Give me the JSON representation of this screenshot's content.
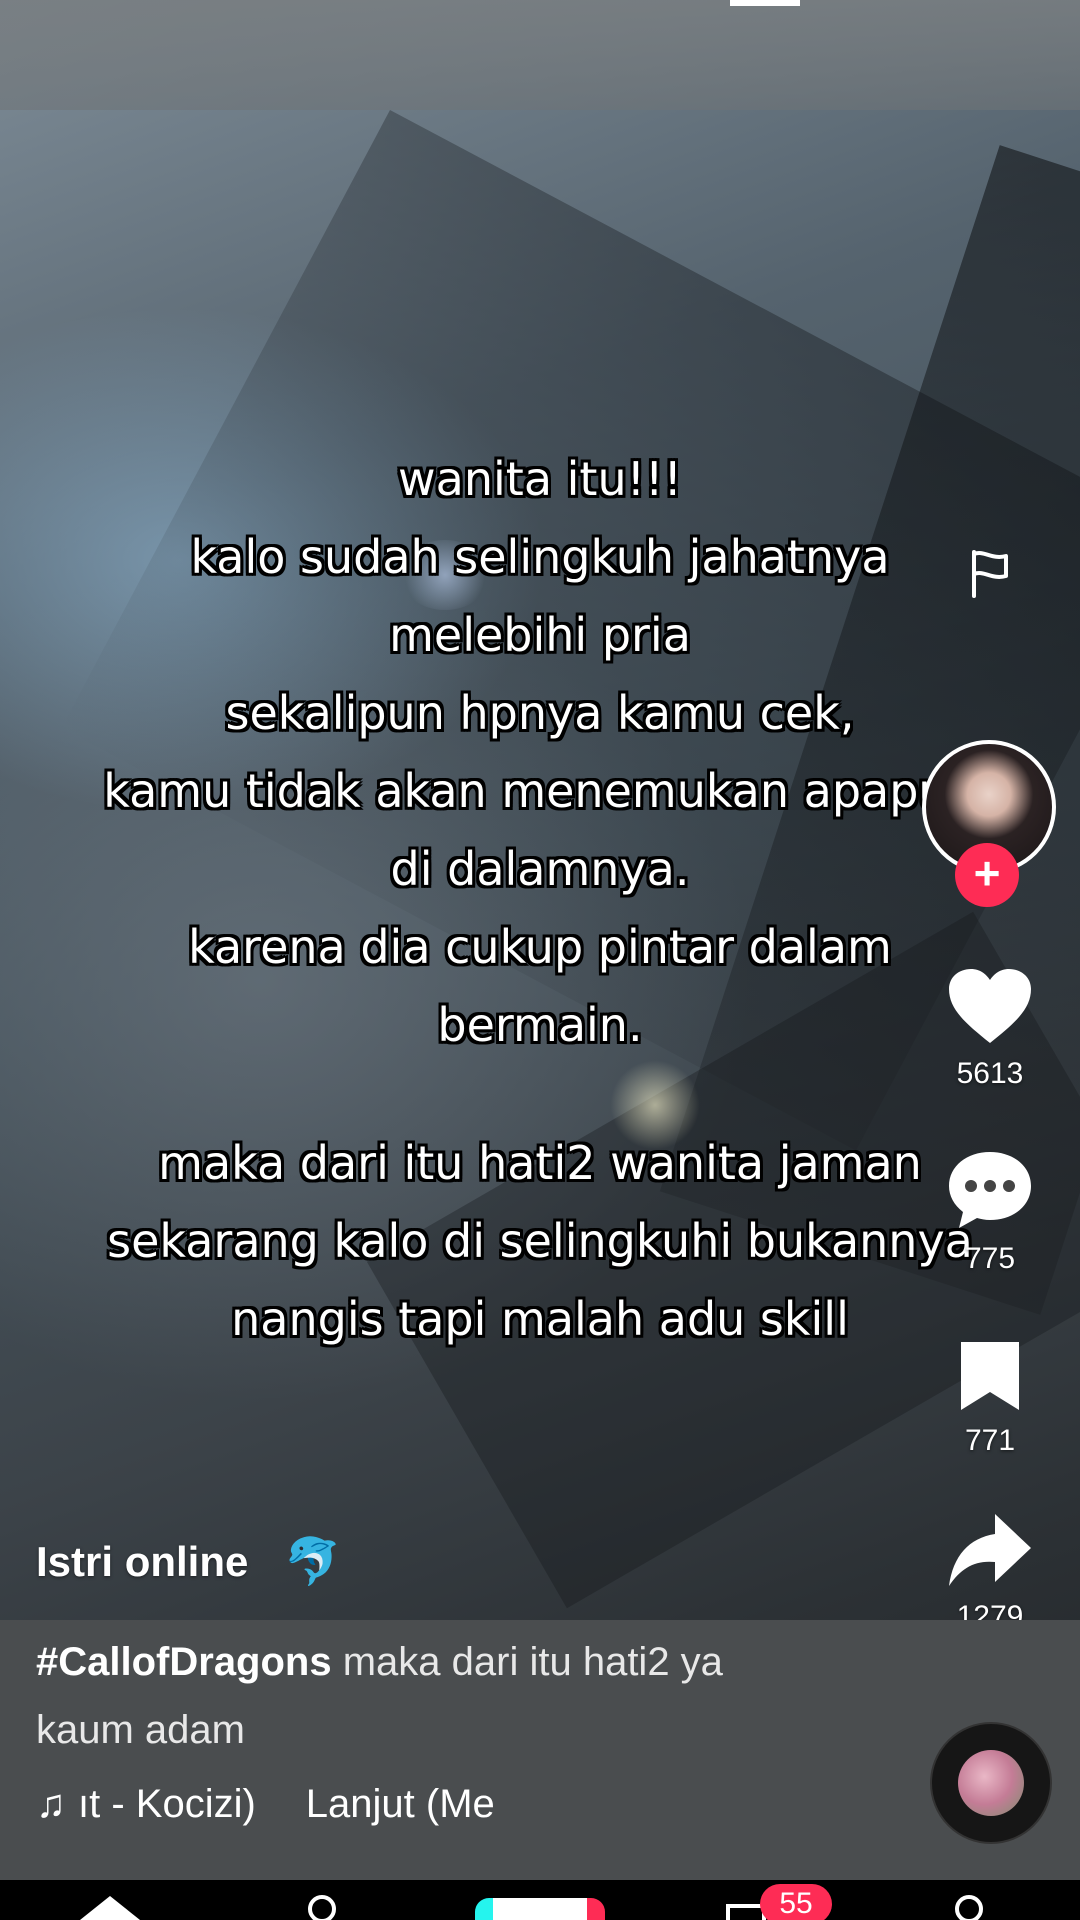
{
  "overlay": {
    "lines": [
      "wanita itu!!!",
      "kalo sudah selingkuh jahatnya",
      "melebihi pria",
      "sekalipun hpnya kamu cek,",
      "kamu tidak akan menemukan apapun",
      "di dalamnya.",
      "karena dia cukup pintar dalam",
      "bermain."
    ],
    "lines2": [
      "maka dari itu hati2 wanita jaman",
      "sekarang kalo di selingkuhi bukannya",
      "nangis tapi malah adu skill"
    ]
  },
  "actions": {
    "likes": "5613",
    "comments": "775",
    "saves": "771",
    "shares": "1279",
    "follow_symbol": "+"
  },
  "post": {
    "author": "Istri online",
    "author_emoji": "🐬",
    "hashtag": "#CallofDragons",
    "description": " maka dari itu hati2 ya kaum adam",
    "music_note": "♫",
    "music_part1": "ıt - Kocizi)",
    "music_part2": "Lanjut  (Me"
  },
  "nav": {
    "inbox_badge": "55"
  },
  "icons": {
    "report": "flag-icon",
    "like": "heart-icon",
    "comment": "comment-bubble-icon",
    "save": "bookmark-icon",
    "share": "share-arrow-icon"
  },
  "colors": {
    "accent": "#fe2c55",
    "text": "#ffffff"
  }
}
